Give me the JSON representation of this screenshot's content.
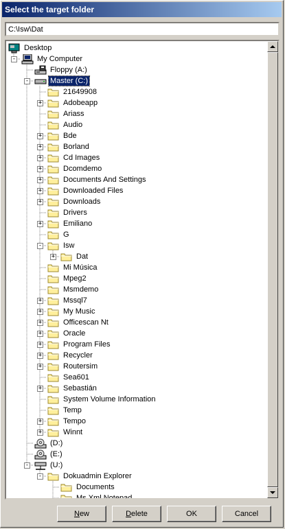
{
  "window": {
    "title": "Select the target folder"
  },
  "path": {
    "value": "C:\\Isw\\Dat"
  },
  "tree": [
    {
      "label": "Desktop",
      "icon": "desktop-icon",
      "level": 0,
      "exp": ""
    },
    {
      "label": "My Computer",
      "icon": "computer-icon",
      "level": 1,
      "exp": "-"
    },
    {
      "label": "Floppy (A:)",
      "icon": "floppy-drive-icon",
      "level": 2,
      "exp": ""
    },
    {
      "label": "Master (C:)",
      "icon": "hard-drive-icon",
      "level": 2,
      "exp": "-",
      "selected": true
    },
    {
      "label": "21649908",
      "icon": "folder-icon",
      "level": 3,
      "exp": ""
    },
    {
      "label": "Adobeapp",
      "icon": "folder-icon",
      "level": 3,
      "exp": "+"
    },
    {
      "label": "Ariass",
      "icon": "folder-icon",
      "level": 3,
      "exp": ""
    },
    {
      "label": "Audio",
      "icon": "folder-icon",
      "level": 3,
      "exp": ""
    },
    {
      "label": "Bde",
      "icon": "folder-icon",
      "level": 3,
      "exp": "+"
    },
    {
      "label": "Borland",
      "icon": "folder-icon",
      "level": 3,
      "exp": "+"
    },
    {
      "label": "Cd Images",
      "icon": "folder-icon",
      "level": 3,
      "exp": "+"
    },
    {
      "label": "Dcomdemo",
      "icon": "folder-icon",
      "level": 3,
      "exp": "+"
    },
    {
      "label": "Documents And Settings",
      "icon": "folder-icon",
      "level": 3,
      "exp": "+"
    },
    {
      "label": "Downloaded Files",
      "icon": "folder-icon",
      "level": 3,
      "exp": "+"
    },
    {
      "label": "Downloads",
      "icon": "folder-icon",
      "level": 3,
      "exp": "+"
    },
    {
      "label": "Drivers",
      "icon": "folder-icon",
      "level": 3,
      "exp": ""
    },
    {
      "label": "Emiliano",
      "icon": "folder-icon",
      "level": 3,
      "exp": "+"
    },
    {
      "label": "G",
      "icon": "folder-icon",
      "level": 3,
      "exp": ""
    },
    {
      "label": "Isw",
      "icon": "folder-icon",
      "level": 3,
      "exp": "-"
    },
    {
      "label": "Dat",
      "icon": "folder-icon",
      "level": 4,
      "exp": "+"
    },
    {
      "label": "Mi Música",
      "icon": "folder-icon",
      "level": 3,
      "exp": ""
    },
    {
      "label": "Mpeg2",
      "icon": "folder-icon",
      "level": 3,
      "exp": ""
    },
    {
      "label": "Msmdemo",
      "icon": "folder-icon",
      "level": 3,
      "exp": ""
    },
    {
      "label": "Mssql7",
      "icon": "folder-icon",
      "level": 3,
      "exp": "+"
    },
    {
      "label": "My Music",
      "icon": "folder-icon",
      "level": 3,
      "exp": "+"
    },
    {
      "label": "Officescan Nt",
      "icon": "folder-icon",
      "level": 3,
      "exp": "+"
    },
    {
      "label": "Oracle",
      "icon": "folder-icon",
      "level": 3,
      "exp": "+"
    },
    {
      "label": "Program Files",
      "icon": "folder-icon",
      "level": 3,
      "exp": "+"
    },
    {
      "label": "Recycler",
      "icon": "folder-icon",
      "level": 3,
      "exp": "+"
    },
    {
      "label": "Routersim",
      "icon": "folder-icon",
      "level": 3,
      "exp": "+"
    },
    {
      "label": "Sea601",
      "icon": "folder-icon",
      "level": 3,
      "exp": ""
    },
    {
      "label": "Sebastián",
      "icon": "folder-icon",
      "level": 3,
      "exp": "+"
    },
    {
      "label": "System Volume Information",
      "icon": "folder-icon",
      "level": 3,
      "exp": ""
    },
    {
      "label": "Temp",
      "icon": "folder-icon",
      "level": 3,
      "exp": ""
    },
    {
      "label": "Tempo",
      "icon": "folder-icon",
      "level": 3,
      "exp": "+"
    },
    {
      "label": "Winnt",
      "icon": "folder-icon",
      "level": 3,
      "exp": "+"
    },
    {
      "label": "(D:)",
      "icon": "cd-drive-icon",
      "level": 2,
      "exp": ""
    },
    {
      "label": "(E:)",
      "icon": "cd-drive-icon",
      "level": 2,
      "exp": ""
    },
    {
      "label": "(U:)",
      "icon": "network-drive-icon",
      "level": 2,
      "exp": "-"
    },
    {
      "label": "Dokuadmin Explorer",
      "icon": "folder-icon",
      "level": 3,
      "exp": "-"
    },
    {
      "label": "Documents",
      "icon": "folder-icon",
      "level": 4,
      "exp": ""
    },
    {
      "label": "Ms Xml Notepad",
      "icon": "folder-icon",
      "level": 4,
      "exp": ""
    }
  ],
  "buttons": {
    "new": {
      "label": "New",
      "mnemonic": "N"
    },
    "delete": {
      "label": "Delete",
      "mnemonic": "D"
    },
    "ok": {
      "label": "OK"
    },
    "cancel": {
      "label": "Cancel"
    }
  },
  "colors": {
    "selection": "#0a246a",
    "title_start": "#0a246a",
    "title_end": "#a6caf0",
    "folder": "#ffef9c",
    "folder_edge": "#9c8a30"
  }
}
